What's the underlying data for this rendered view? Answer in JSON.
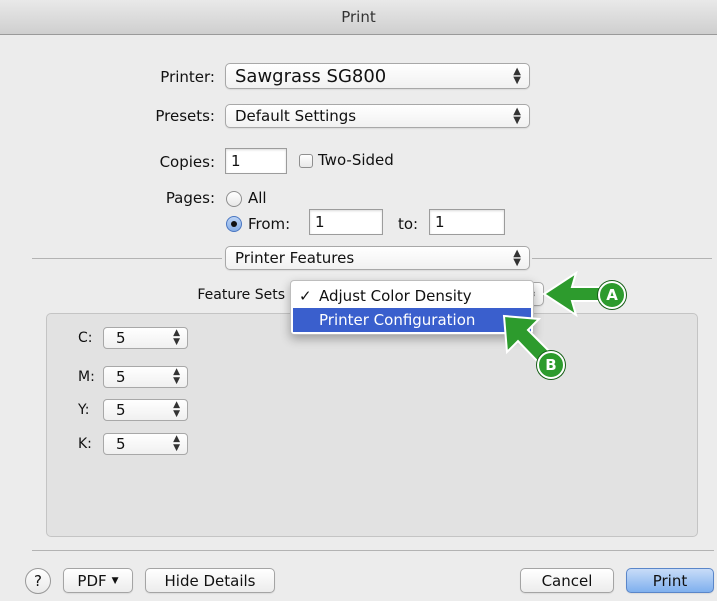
{
  "window": {
    "title": "Print"
  },
  "printer": {
    "label": "Printer:",
    "value": "Sawgrass SG800"
  },
  "presets": {
    "label": "Presets:",
    "value": "Default Settings"
  },
  "copies": {
    "label": "Copies:",
    "value": "1",
    "two_sided_label": "Two-Sided"
  },
  "pages": {
    "label": "Pages:",
    "all_label": "All",
    "from_label": "From:",
    "from_value": "1",
    "to_label": "to:",
    "to_value": "1"
  },
  "section_popup": {
    "value": "Printer Features"
  },
  "feature_sets": {
    "label": "Feature Sets",
    "menu_items": [
      {
        "label": "Adjust Color Density",
        "checked": true
      },
      {
        "label": "Printer Configuration",
        "highlighted": true
      }
    ]
  },
  "color_density": [
    {
      "label": "C:",
      "value": "5"
    },
    {
      "label": "M:",
      "value": "5"
    },
    {
      "label": "Y:",
      "value": "5"
    },
    {
      "label": "K:",
      "value": "5"
    }
  ],
  "callouts": {
    "a": "A",
    "b": "B",
    "color": "#2d9b2d"
  },
  "footer": {
    "help_label": "?",
    "pdf_label": "PDF",
    "hide_details_label": "Hide Details",
    "cancel_label": "Cancel",
    "print_label": "Print"
  },
  "colors": {
    "menu_highlight": "#3a5fcd",
    "default_button": "#7fb0ee"
  }
}
